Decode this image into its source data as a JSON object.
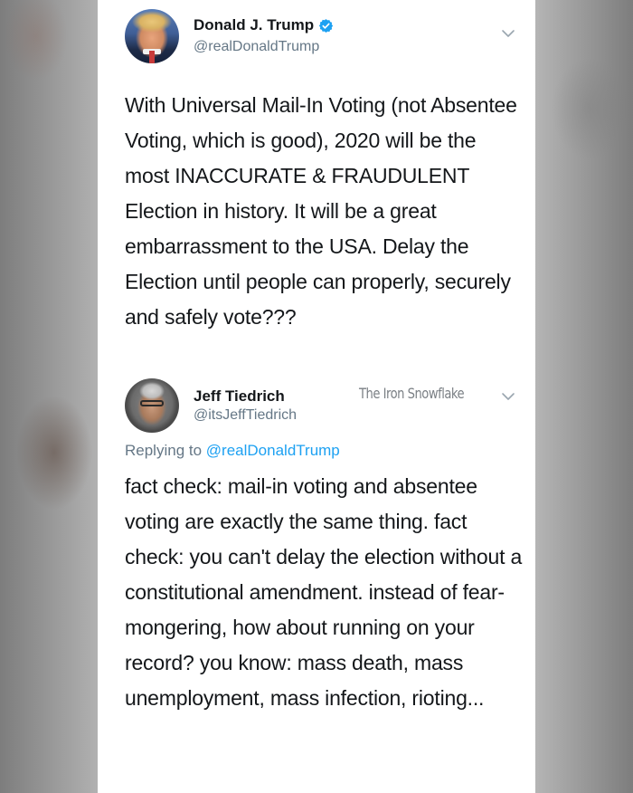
{
  "tweet": {
    "author_name": "Donald J. Trump",
    "author_handle": "@realDonaldTrump",
    "verified": true,
    "text": "With Universal Mail-In Voting (not Absentee Voting, which is good), 2020 will be the most INACCURATE & FRAUDULENT Election in history. It will be a great embarrassment to the USA. Delay the Election until people can properly, securely and safely vote???"
  },
  "reply": {
    "author_name": "Jeff Tiedrich",
    "author_handle": "@itsJeffTiedrich",
    "watermark": "The Iron Snowflake",
    "replying_prefix": "Replying to",
    "replying_mention": "@realDonaldTrump",
    "text": "fact check: mail-in voting and absentee voting are exactly the same thing. fact check: you can't delay the election without a constitutional amendment. instead of fear-mongering, how about running on your record? you know: mass death, mass unemployment, mass infection, rioting..."
  },
  "icons": {
    "verified": "verified-badge-icon",
    "more": "chevron-down-icon"
  },
  "colors": {
    "verified_blue": "#1da1f2",
    "mention_blue": "#1da1f2",
    "handle_gray": "#657786"
  }
}
